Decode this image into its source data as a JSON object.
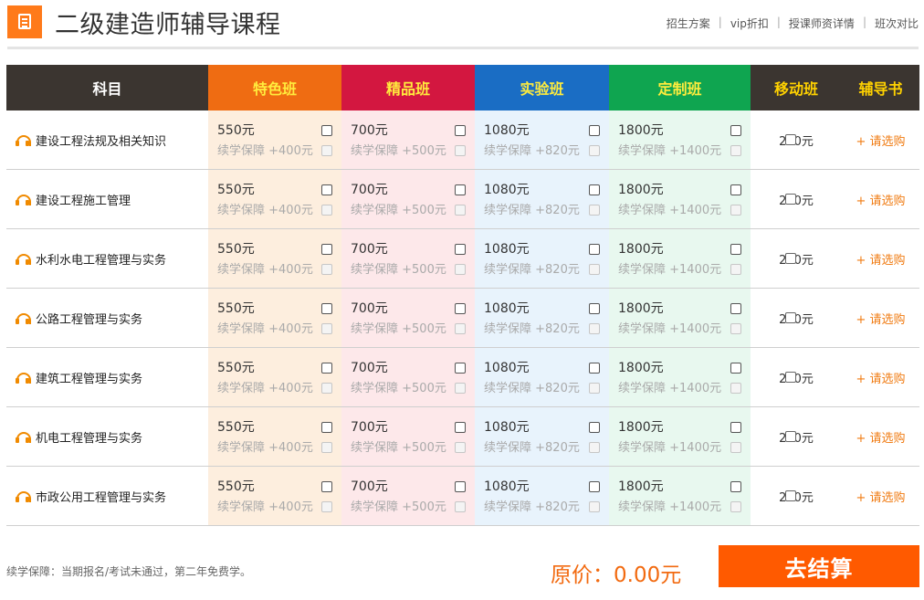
{
  "header": {
    "title": "二级建造师辅导课程",
    "links": [
      "招生方案",
      "vip折扣",
      "授课师资详情",
      "班次对比"
    ]
  },
  "table": {
    "headers": {
      "subject": "科目",
      "a": "特色班",
      "b": "精品班",
      "c": "实验班",
      "d": "定制班",
      "mobile": "移动班",
      "book": "辅导书"
    },
    "rows": [
      {
        "subject": "建设工程法规及相关知识",
        "a_price": "550元",
        "a_extra": "续学保障 +400元",
        "b_price": "700元",
        "b_extra": "续学保障 +500元",
        "c_price": "1080元",
        "c_extra": "续学保障 +820元",
        "d_price": "1800元",
        "d_extra": "续学保障 +1400元",
        "mobile": "200元",
        "book": "+ 请选购"
      },
      {
        "subject": "建设工程施工管理",
        "a_price": "550元",
        "a_extra": "续学保障 +400元",
        "b_price": "700元",
        "b_extra": "续学保障 +500元",
        "c_price": "1080元",
        "c_extra": "续学保障 +820元",
        "d_price": "1800元",
        "d_extra": "续学保障 +1400元",
        "mobile": "200元",
        "book": "+ 请选购"
      },
      {
        "subject": "水利水电工程管理与实务",
        "a_price": "550元",
        "a_extra": "续学保障 +400元",
        "b_price": "700元",
        "b_extra": "续学保障 +500元",
        "c_price": "1080元",
        "c_extra": "续学保障 +820元",
        "d_price": "1800元",
        "d_extra": "续学保障 +1400元",
        "mobile": "200元",
        "book": "+ 请选购"
      },
      {
        "subject": "公路工程管理与实务",
        "a_price": "550元",
        "a_extra": "续学保障 +400元",
        "b_price": "700元",
        "b_extra": "续学保障 +500元",
        "c_price": "1080元",
        "c_extra": "续学保障 +820元",
        "d_price": "1800元",
        "d_extra": "续学保障 +1400元",
        "mobile": "200元",
        "book": "+ 请选购"
      },
      {
        "subject": "建筑工程管理与实务",
        "a_price": "550元",
        "a_extra": "续学保障 +400元",
        "b_price": "700元",
        "b_extra": "续学保障 +500元",
        "c_price": "1080元",
        "c_extra": "续学保障 +820元",
        "d_price": "1800元",
        "d_extra": "续学保障 +1400元",
        "mobile": "200元",
        "book": "+ 请选购"
      },
      {
        "subject": "机电工程管理与实务",
        "a_price": "550元",
        "a_extra": "续学保障 +400元",
        "b_price": "700元",
        "b_extra": "续学保障 +500元",
        "c_price": "1080元",
        "c_extra": "续学保障 +820元",
        "d_price": "1800元",
        "d_extra": "续学保障 +1400元",
        "mobile": "200元",
        "book": "+ 请选购"
      },
      {
        "subject": "市政公用工程管理与实务",
        "a_price": "550元",
        "a_extra": "续学保障 +400元",
        "b_price": "700元",
        "b_extra": "续学保障 +500元",
        "c_price": "1080元",
        "c_extra": "续学保障 +820元",
        "d_price": "1800元",
        "d_extra": "续学保障 +1400元",
        "mobile": "200元",
        "book": "+ 请选购"
      }
    ]
  },
  "footer": {
    "note": "续学保障：当期报名/考试未通过，第二年免费学。",
    "original_price": "原价：0.00元",
    "checkout_label": "去结算"
  },
  "colors": {
    "accent": "#ff5a00",
    "header_dark": "#3b3530",
    "col_a": "#ef6c12",
    "col_b": "#d31740",
    "col_c": "#1a6dc4",
    "col_d": "#0fa550"
  }
}
